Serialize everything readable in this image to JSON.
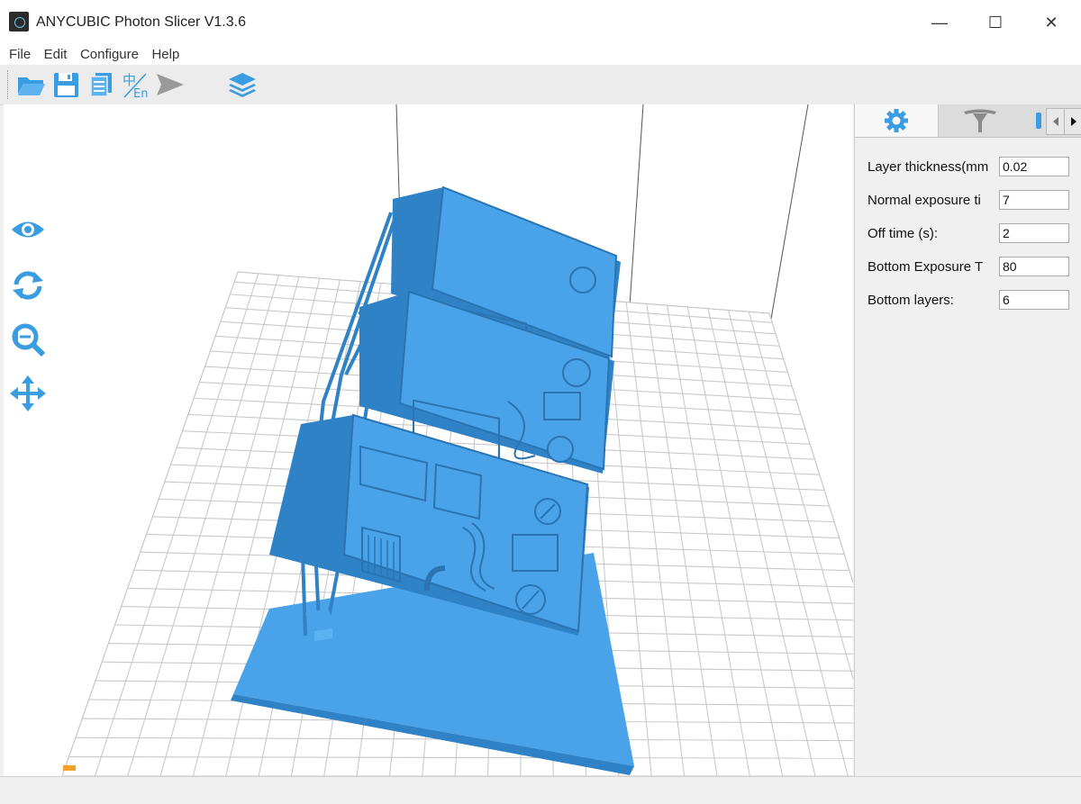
{
  "window": {
    "title": "ANYCUBIC Photon Slicer V1.3.6",
    "controls": {
      "minimize": "—",
      "maximize": "☐",
      "close": "✕"
    }
  },
  "menu": {
    "items": [
      "File",
      "Edit",
      "Configure",
      "Help"
    ]
  },
  "toolbar": {
    "icons": [
      "open-folder-icon",
      "save-icon",
      "slice-icon",
      "language-icon",
      "send-icon",
      "layers-icon"
    ],
    "language_label": "En"
  },
  "view_tools": [
    "eye-icon",
    "rotate-icon",
    "zoom-icon",
    "move-icon"
  ],
  "sidebar": {
    "tabs": [
      "settings-gear-icon",
      "support-icon",
      "partial-tab-icon"
    ],
    "fields": [
      {
        "label": "Layer thickness(mm",
        "value": "0.02"
      },
      {
        "label": "Normal exposure ti",
        "value": "7"
      },
      {
        "label": "Off time (s):",
        "value": "2"
      },
      {
        "label": "Bottom Exposure T",
        "value": "80"
      },
      {
        "label": "Bottom layers:",
        "value": "6"
      }
    ]
  },
  "colors": {
    "accent": "#3b9de1",
    "model": "#4aa3e8",
    "model_dark": "#2f82c6",
    "grid": "#c9c9c9"
  }
}
